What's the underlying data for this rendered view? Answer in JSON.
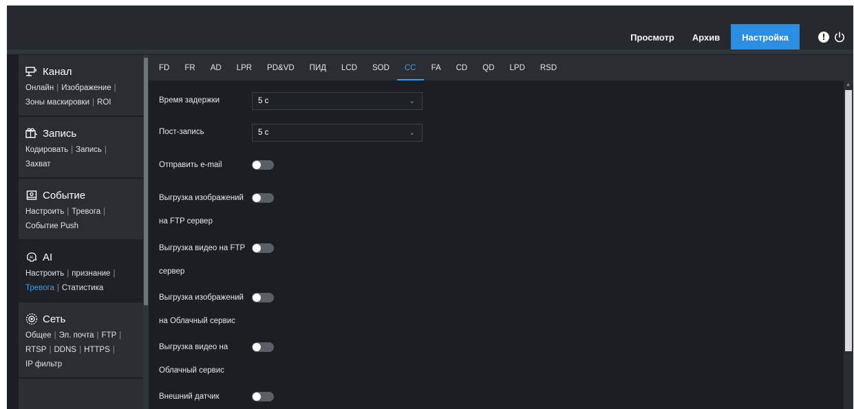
{
  "topnav": {
    "view": "Просмотр",
    "archive": "Архив",
    "settings": "Настройка"
  },
  "icons": {
    "alert": "alert-icon",
    "power": "power-icon"
  },
  "accent_color": "#2c8ee2",
  "sidebar": {
    "sections": [
      {
        "title": "Канал",
        "icon": "camera-icon",
        "links": [
          "Онлайн",
          "Изображение",
          "Зоны маскировки",
          "ROI"
        ]
      },
      {
        "title": "Запись",
        "icon": "record-icon",
        "links": [
          "Кодировать",
          "Запись",
          "Захват"
        ]
      },
      {
        "title": "Событие",
        "icon": "event-icon",
        "links": [
          "Настроить",
          "Тревога",
          "Событие Push"
        ]
      },
      {
        "title": "AI",
        "icon": "ai-icon",
        "links": [
          "Настроить",
          "признание",
          "Тревога",
          "Статистика"
        ],
        "active_link": "Тревога"
      },
      {
        "title": "Сеть",
        "icon": "network-icon",
        "links": [
          "Общее",
          "Эл. почта",
          "FTP",
          "RTSP",
          "DDNS",
          "HTTPS",
          "IP фильтр"
        ]
      }
    ]
  },
  "tabs": [
    "FD",
    "FR",
    "AD",
    "LPR",
    "PD&VD",
    "ПИД",
    "LCD",
    "SOD",
    "CC",
    "FA",
    "CD",
    "QD",
    "LPD",
    "RSD"
  ],
  "active_tab": "CC",
  "form": {
    "delay_label": "Время задержки",
    "delay_value": "5 с",
    "post_record_label": "Пост-запись",
    "post_record_value": "5 с",
    "send_email_label": "Отправить e-mail",
    "send_email_on": false,
    "ftp_image_label_1": "Выгрузка изображений",
    "ftp_image_label_2": "на FTP сервер",
    "ftp_image_on": false,
    "ftp_video_label_1": "Выгрузка видео на FTP",
    "ftp_video_label_2": "сервер",
    "ftp_video_on": false,
    "cloud_image_label_1": "Выгрузка изображений",
    "cloud_image_label_2": "на Облачный сервис",
    "cloud_image_on": false,
    "cloud_video_label_1": "Выгрузка видео на",
    "cloud_video_label_2": "Облачный сервис",
    "cloud_video_on": false,
    "ext_sensor_label": "Внешний датчик",
    "ext_sensor_on": false
  }
}
